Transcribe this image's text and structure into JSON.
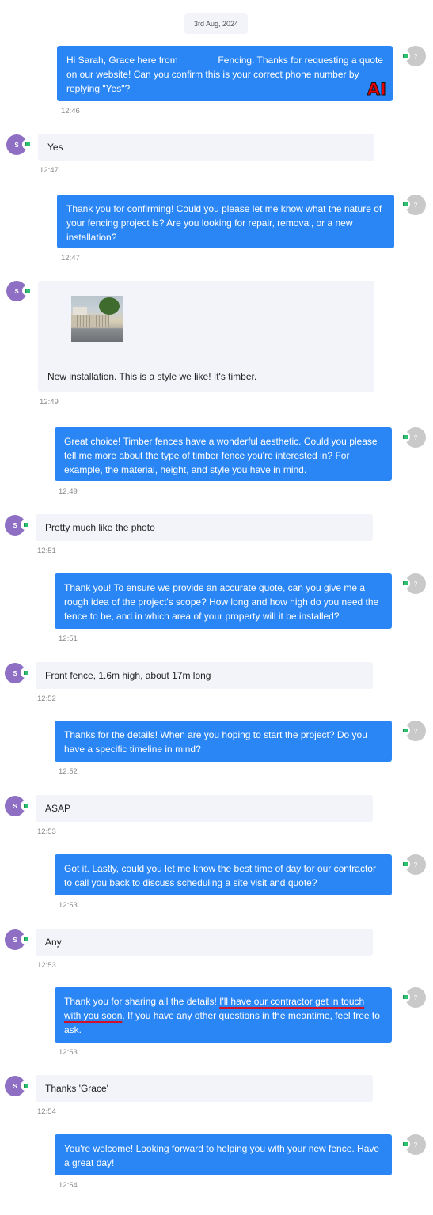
{
  "date_label": "3rd Aug, 2024",
  "agent_avatar_text": "?",
  "user_avatar_text": "S",
  "watermark": "AI",
  "messages": [
    {
      "sender": "agent",
      "text_a": "Hi Sarah, Grace here from ",
      "redacted": true,
      "text_b": " Fencing. Thanks for requesting a quote on our website! Can you confirm this is your correct phone number by replying \"Yes\"?",
      "time": "12:46"
    },
    {
      "sender": "user",
      "text": "Yes",
      "time": "12:47"
    },
    {
      "sender": "agent",
      "text": "Thank you for confirming! Could you please let me know what the nature of your fencing project is? Are you looking for repair, removal, or a new installation?",
      "time": "12:47"
    },
    {
      "sender": "user",
      "text": "New installation. This is a style we like! It's timber.",
      "has_photo": true,
      "time": "12:49"
    },
    {
      "sender": "agent",
      "text": "Great choice! Timber fences have a wonderful aesthetic. Could you please tell me more about the type of timber fence you're interested in? For example, the material, height, and style you have in mind.",
      "time": "12:49"
    },
    {
      "sender": "user",
      "text": "Pretty much like the photo",
      "time": "12:51"
    },
    {
      "sender": "agent",
      "text": "Thank you! To ensure we provide an accurate quote, can you give me a rough idea of the project's scope? How long and how high do you need the fence to be, and in which area of your property will it be installed?",
      "time": "12:51"
    },
    {
      "sender": "user",
      "text": "Front fence, 1.6m high, about 17m long",
      "time": "12:52"
    },
    {
      "sender": "agent",
      "text": "Thanks for the details! When are you hoping to start the project? Do you have a specific timeline in mind?",
      "time": "12:52"
    },
    {
      "sender": "user",
      "text": "ASAP",
      "time": "12:53"
    },
    {
      "sender": "agent",
      "text": "Got it. Lastly, could you let me know the best time of day for our contractor to call you back to discuss scheduling a site visit and quote?",
      "time": "12:53"
    },
    {
      "sender": "user",
      "text": "Any",
      "time": "12:53"
    },
    {
      "sender": "agent",
      "text_a": "Thank you for sharing all the details! ",
      "text_u": "I'll have our contractor get in touch with you soon",
      "text_b": ". If you have any other questions in the meantime, feel free to ask.",
      "time": "12:53"
    },
    {
      "sender": "user",
      "text": "Thanks 'Grace'",
      "time": "12:54"
    },
    {
      "sender": "agent",
      "text": "You're welcome! Looking forward to helping you with your new fence. Have a great day!",
      "time": "12:54"
    }
  ]
}
